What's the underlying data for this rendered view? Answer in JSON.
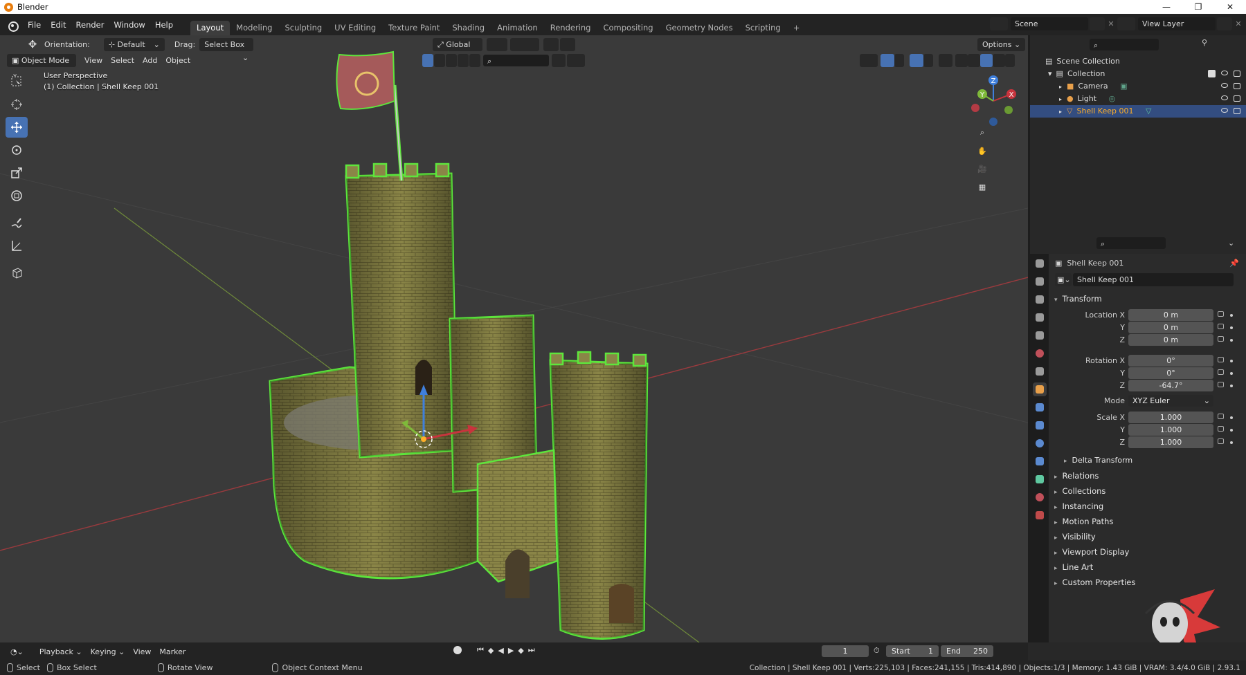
{
  "window": {
    "title": "Blender",
    "controls": [
      "—",
      "❐",
      "✕"
    ]
  },
  "menubar": {
    "menus": [
      "File",
      "Edit",
      "Render",
      "Window",
      "Help"
    ],
    "workspaces": [
      "Layout",
      "Modeling",
      "Sculpting",
      "UV Editing",
      "Texture Paint",
      "Shading",
      "Animation",
      "Rendering",
      "Compositing",
      "Geometry Nodes",
      "Scripting"
    ],
    "active_workspace": "Layout",
    "add_workspace": "+",
    "scene_name": "Scene",
    "view_layer": "View Layer"
  },
  "viewport_header": {
    "orientation_label": "Orientation:",
    "orientation_value": "Default",
    "drag_label": "Drag:",
    "drag_value": "Select Box",
    "transform_space": "Global",
    "options_label": "Options",
    "mode": "Object Mode",
    "menus": [
      "View",
      "Select",
      "Add",
      "Object"
    ]
  },
  "viewport": {
    "perspective_label": "User Perspective",
    "collection_label": "(1) Collection | Shell Keep 001",
    "gizmo_axes": [
      "X",
      "Y",
      "Z"
    ],
    "colors": {
      "x_axis": "#c8343d",
      "y_axis": "#7fb93a",
      "z_axis": "#3f7fdc",
      "selection_outline": "#5ee63c"
    }
  },
  "outliner": {
    "search_placeholder": "",
    "root": "Scene Collection",
    "collection": "Collection",
    "items": [
      {
        "name": "Camera",
        "selected": false
      },
      {
        "name": "Light",
        "selected": false
      },
      {
        "name": "Shell Keep 001",
        "selected": true
      }
    ]
  },
  "properties": {
    "object_name": "Shell Keep 001",
    "datablock_name": "Shell Keep 001",
    "transform_title": "Transform",
    "location": {
      "label": "Location X",
      "x": "0 m",
      "y": "0 m",
      "z": "0 m"
    },
    "rotation": {
      "label": "Rotation X",
      "x": "0°",
      "y": "0°",
      "z": "-64.7°"
    },
    "mode_label": "Mode",
    "mode_value": "XYZ Euler",
    "scale": {
      "label": "Scale X",
      "x": "1.000",
      "y": "1.000",
      "z": "1.000"
    },
    "axis_y": "Y",
    "axis_z": "Z",
    "delta_transform": "Delta Transform",
    "panels": [
      "Relations",
      "Collections",
      "Instancing",
      "Motion Paths",
      "Visibility",
      "Viewport Display",
      "Line Art",
      "Custom Properties"
    ]
  },
  "timeline": {
    "menus": [
      "Playback",
      "Keying",
      "View",
      "Marker"
    ],
    "current_frame": "1",
    "start_label": "Start",
    "start_value": "1",
    "end_label": "End",
    "end_value": "250"
  },
  "statusbar": {
    "select": "Select",
    "box_select": "Box Select",
    "rotate_view": "Rotate View",
    "context_menu": "Object Context Menu",
    "stats": "Collection | Shell Keep 001 | Verts:225,103 | Faces:241,155 | Tris:414,890 | Objects:1/3 | Memory: 1.43 GiB | VRAM: 3.4/4.0 GiB | 2.93.1"
  }
}
